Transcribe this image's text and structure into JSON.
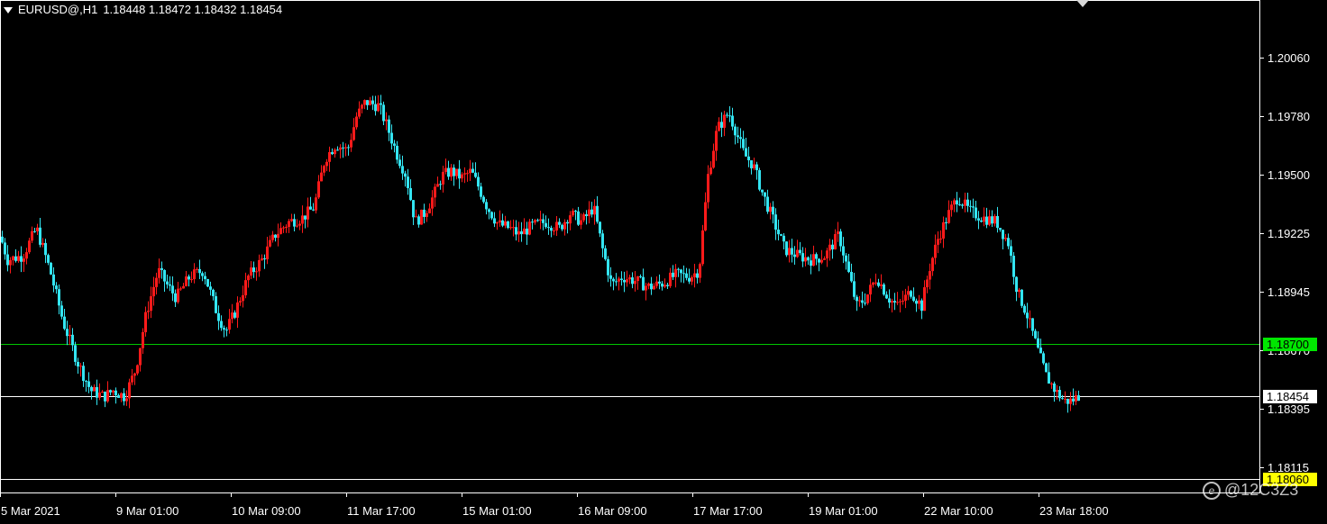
{
  "header": {
    "symbol": "EURUSD@,H1",
    "ohlc": "1.18448 1.18472 1.18432 1.18454"
  },
  "watermark": {
    "text": "@12C3Z3",
    "icon": "weibo-icon"
  },
  "colors": {
    "bull": "#ff1a1a",
    "bear": "#33e5f2",
    "background": "#000000",
    "frame": "#ffffff",
    "level_line": "#00c800",
    "level_label_bg": "#00e600",
    "bid_label_bg": "#ffffff",
    "bottom_label_bg": "#ffff00"
  },
  "chart_data": {
    "type": "candlestick",
    "title": "EURUSD@,H1",
    "timeframe": "H1",
    "price_axis": {
      "ticks": [
        "1.20060",
        "1.19780",
        "1.19500",
        "1.19225",
        "1.18945",
        "1.18670",
        "1.18395",
        "1.18115"
      ],
      "range": [
        1.18065,
        1.20285
      ]
    },
    "time_axis": {
      "labels": [
        "5 Mar 2021",
        "9 Mar 01:00",
        "10 Mar 09:00",
        "11 Mar 17:00",
        "15 Mar 01:00",
        "16 Mar 09:00",
        "17 Mar 17:00",
        "19 Mar 01:00",
        "22 Mar 10:00",
        "23 Mar 18:00"
      ]
    },
    "horizontal_levels": [
      {
        "price": 1.187,
        "label": "1.18700",
        "color": "#00c800",
        "label_bg": "#00e600",
        "label_fg": "#000000"
      },
      {
        "price": 1.18454,
        "label": "1.18454",
        "color": "#ffffff",
        "label_bg": "#ffffff",
        "label_fg": "#000000"
      },
      {
        "price": 1.1806,
        "label": "1.18060",
        "color": "#ffffff",
        "label_bg": "#ffff00",
        "label_fg": "#000000"
      }
    ],
    "last_price": 1.18454,
    "path_points": [
      [
        0,
        1.1921
      ],
      [
        8,
        1.191
      ],
      [
        25,
        1.1912
      ],
      [
        40,
        1.1925
      ],
      [
        55,
        1.1905
      ],
      [
        70,
        1.188
      ],
      [
        85,
        1.1862
      ],
      [
        100,
        1.1848
      ],
      [
        115,
        1.1845
      ],
      [
        125,
        1.1848
      ],
      [
        138,
        1.1845
      ],
      [
        150,
        1.1858
      ],
      [
        162,
        1.1885
      ],
      [
        175,
        1.1905
      ],
      [
        185,
        1.1898
      ],
      [
        195,
        1.1892
      ],
      [
        210,
        1.1902
      ],
      [
        225,
        1.1905
      ],
      [
        240,
        1.1885
      ],
      [
        250,
        1.1876
      ],
      [
        260,
        1.1885
      ],
      [
        275,
        1.1902
      ],
      [
        290,
        1.191
      ],
      [
        305,
        1.1922
      ],
      [
        320,
        1.1928
      ],
      [
        335,
        1.193
      ],
      [
        348,
        1.1935
      ],
      [
        360,
        1.1958
      ],
      [
        372,
        1.1965
      ],
      [
        385,
        1.1962
      ],
      [
        395,
        1.1978
      ],
      [
        405,
        1.1985
      ],
      [
        420,
        1.1983
      ],
      [
        430,
        1.1972
      ],
      [
        440,
        1.196
      ],
      [
        450,
        1.195
      ],
      [
        460,
        1.1928
      ],
      [
        470,
        1.1932
      ],
      [
        480,
        1.194
      ],
      [
        490,
        1.195
      ],
      [
        500,
        1.1952
      ],
      [
        512,
        1.1949
      ],
      [
        522,
        1.1952
      ],
      [
        530,
        1.1945
      ],
      [
        540,
        1.1935
      ],
      [
        552,
        1.1927
      ],
      [
        565,
        1.1925
      ],
      [
        575,
        1.1922
      ],
      [
        590,
        1.1926
      ],
      [
        605,
        1.1928
      ],
      [
        620,
        1.1925
      ],
      [
        632,
        1.1932
      ],
      [
        645,
        1.1928
      ],
      [
        658,
        1.1935
      ],
      [
        668,
        1.1915
      ],
      [
        678,
        1.1898
      ],
      [
        690,
        1.1902
      ],
      [
        705,
        1.19
      ],
      [
        720,
        1.1897
      ],
      [
        735,
        1.1899
      ],
      [
        750,
        1.1903
      ],
      [
        765,
        1.1902
      ],
      [
        775,
        1.1905
      ],
      [
        785,
        1.195
      ],
      [
        795,
        1.1972
      ],
      [
        808,
        1.198
      ],
      [
        815,
        1.1972
      ],
      [
        825,
        1.196
      ],
      [
        835,
        1.1955
      ],
      [
        845,
        1.1942
      ],
      [
        858,
        1.1928
      ],
      [
        870,
        1.1915
      ],
      [
        885,
        1.1912
      ],
      [
        900,
        1.191
      ],
      [
        915,
        1.1912
      ],
      [
        930,
        1.1922
      ],
      [
        940,
        1.1905
      ],
      [
        950,
        1.1888
      ],
      [
        960,
        1.1892
      ],
      [
        972,
        1.1902
      ],
      [
        985,
        1.1892
      ],
      [
        995,
        1.1888
      ],
      [
        1010,
        1.1895
      ],
      [
        1022,
        1.1888
      ],
      [
        1030,
        1.1905
      ],
      [
        1040,
        1.192
      ],
      [
        1052,
        1.1932
      ],
      [
        1062,
        1.194
      ],
      [
        1075,
        1.1933
      ],
      [
        1090,
        1.193
      ],
      [
        1105,
        1.1928
      ],
      [
        1118,
        1.1918
      ],
      [
        1128,
        1.1895
      ],
      [
        1138,
        1.1885
      ],
      [
        1150,
        1.1868
      ],
      [
        1160,
        1.1855
      ],
      [
        1170,
        1.1848
      ],
      [
        1180,
        1.1843
      ],
      [
        1188,
        1.1843
      ],
      [
        1196,
        1.18454
      ]
    ]
  }
}
